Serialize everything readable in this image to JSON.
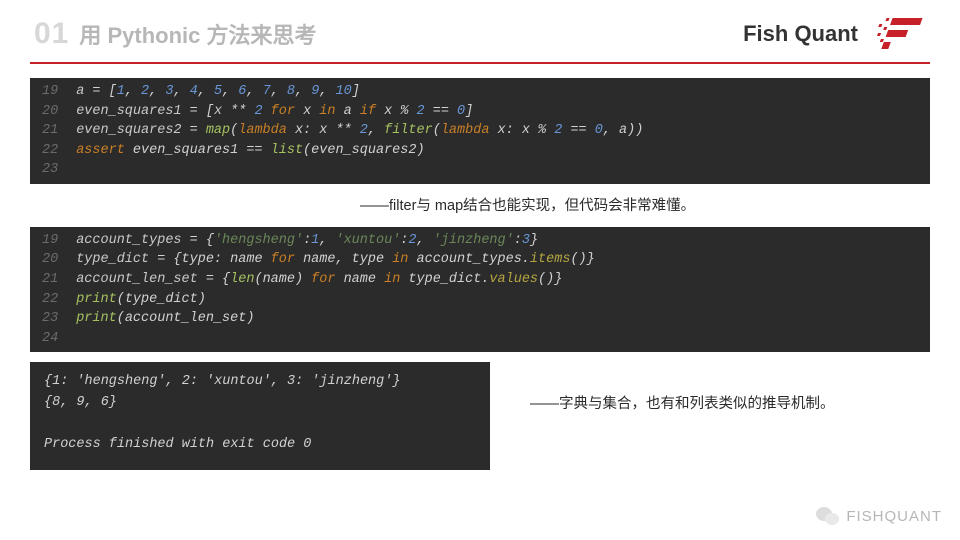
{
  "header": {
    "chapter_num": "01",
    "chapter_title": "用 Pythonic 方法来思考",
    "brand": "Fish Quant"
  },
  "block1": {
    "gutter": [
      "19",
      "20",
      "21",
      "22",
      "23"
    ],
    "lines": [
      [
        {
          "c": "var",
          "t": "a "
        },
        {
          "c": "op",
          "t": "= "
        },
        {
          "c": "par",
          "t": "["
        },
        {
          "c": "num",
          "t": "1"
        },
        {
          "c": "op",
          "t": ", "
        },
        {
          "c": "num",
          "t": "2"
        },
        {
          "c": "op",
          "t": ", "
        },
        {
          "c": "num",
          "t": "3"
        },
        {
          "c": "op",
          "t": ", "
        },
        {
          "c": "num",
          "t": "4"
        },
        {
          "c": "op",
          "t": ", "
        },
        {
          "c": "num",
          "t": "5"
        },
        {
          "c": "op",
          "t": ", "
        },
        {
          "c": "num",
          "t": "6"
        },
        {
          "c": "op",
          "t": ", "
        },
        {
          "c": "num",
          "t": "7"
        },
        {
          "c": "op",
          "t": ", "
        },
        {
          "c": "num",
          "t": "8"
        },
        {
          "c": "op",
          "t": ", "
        },
        {
          "c": "num",
          "t": "9"
        },
        {
          "c": "op",
          "t": ", "
        },
        {
          "c": "num",
          "t": "10"
        },
        {
          "c": "par",
          "t": "]"
        }
      ],
      [
        {
          "c": "var",
          "t": "even_squares1 "
        },
        {
          "c": "op",
          "t": "= "
        },
        {
          "c": "par",
          "t": "["
        },
        {
          "c": "var",
          "t": "x "
        },
        {
          "c": "op",
          "t": "** "
        },
        {
          "c": "num",
          "t": "2"
        },
        {
          "c": "op",
          "t": " "
        },
        {
          "c": "kw",
          "t": "for"
        },
        {
          "c": "op",
          "t": " x "
        },
        {
          "c": "kw",
          "t": "in"
        },
        {
          "c": "op",
          "t": " a "
        },
        {
          "c": "kw",
          "t": "if"
        },
        {
          "c": "op",
          "t": " x % "
        },
        {
          "c": "num",
          "t": "2"
        },
        {
          "c": "op",
          "t": " == "
        },
        {
          "c": "num",
          "t": "0"
        },
        {
          "c": "par",
          "t": "]"
        }
      ],
      [
        {
          "c": "var",
          "t": "even_squares2 "
        },
        {
          "c": "op",
          "t": "= "
        },
        {
          "c": "fn",
          "t": "map"
        },
        {
          "c": "par",
          "t": "("
        },
        {
          "c": "kw",
          "t": "lambda"
        },
        {
          "c": "op",
          "t": " x: x ** "
        },
        {
          "c": "num",
          "t": "2"
        },
        {
          "c": "op",
          "t": ", "
        },
        {
          "c": "fn",
          "t": "filter"
        },
        {
          "c": "par",
          "t": "("
        },
        {
          "c": "kw",
          "t": "lambda"
        },
        {
          "c": "op",
          "t": " x: x % "
        },
        {
          "c": "num",
          "t": "2"
        },
        {
          "c": "op",
          "t": " == "
        },
        {
          "c": "num",
          "t": "0"
        },
        {
          "c": "op",
          "t": ", a"
        },
        {
          "c": "par",
          "t": "))"
        }
      ],
      [
        {
          "c": "kw",
          "t": "assert"
        },
        {
          "c": "op",
          "t": " even_squares1 == "
        },
        {
          "c": "fn",
          "t": "list"
        },
        {
          "c": "par",
          "t": "("
        },
        {
          "c": "op",
          "t": "even_squares2"
        },
        {
          "c": "par",
          "t": ")"
        }
      ],
      [
        {
          "c": "emp",
          "t": " "
        }
      ]
    ]
  },
  "annot1": "——filter与 map结合也能实现，但代码会非常难懂。",
  "block2": {
    "gutter": [
      "19",
      "20",
      "21",
      "22",
      "23",
      "24"
    ],
    "lines": [
      [
        {
          "c": "var",
          "t": "account_types "
        },
        {
          "c": "op",
          "t": "= "
        },
        {
          "c": "par",
          "t": "{"
        },
        {
          "c": "str",
          "t": "'hengsheng'"
        },
        {
          "c": "op",
          "t": ":"
        },
        {
          "c": "num",
          "t": "1"
        },
        {
          "c": "op",
          "t": ", "
        },
        {
          "c": "str",
          "t": "'xuntou'"
        },
        {
          "c": "op",
          "t": ":"
        },
        {
          "c": "num",
          "t": "2"
        },
        {
          "c": "op",
          "t": ", "
        },
        {
          "c": "str",
          "t": "'jinzheng'"
        },
        {
          "c": "op",
          "t": ":"
        },
        {
          "c": "num",
          "t": "3"
        },
        {
          "c": "par",
          "t": "}"
        }
      ],
      [
        {
          "c": "var",
          "t": "type_dict "
        },
        {
          "c": "op",
          "t": "= "
        },
        {
          "c": "par",
          "t": "{"
        },
        {
          "c": "op",
          "t": "type: name "
        },
        {
          "c": "kw",
          "t": "for"
        },
        {
          "c": "op",
          "t": " name, type "
        },
        {
          "c": "kw",
          "t": "in"
        },
        {
          "c": "op",
          "t": " account_types."
        },
        {
          "c": "fn2",
          "t": "items"
        },
        {
          "c": "par",
          "t": "()}"
        }
      ],
      [
        {
          "c": "var",
          "t": "account_len_set "
        },
        {
          "c": "op",
          "t": "= "
        },
        {
          "c": "par",
          "t": "{"
        },
        {
          "c": "fn",
          "t": "len"
        },
        {
          "c": "par",
          "t": "("
        },
        {
          "c": "op",
          "t": "name"
        },
        {
          "c": "par",
          "t": ") "
        },
        {
          "c": "kw",
          "t": "for"
        },
        {
          "c": "op",
          "t": " name "
        },
        {
          "c": "kw",
          "t": "in"
        },
        {
          "c": "op",
          "t": " type_dict."
        },
        {
          "c": "fn2",
          "t": "values"
        },
        {
          "c": "par",
          "t": "()}"
        }
      ],
      [
        {
          "c": "fn",
          "t": "print"
        },
        {
          "c": "par",
          "t": "("
        },
        {
          "c": "op",
          "t": "type_dict"
        },
        {
          "c": "par",
          "t": ")"
        }
      ],
      [
        {
          "c": "fn",
          "t": "print"
        },
        {
          "c": "par",
          "t": "("
        },
        {
          "c": "op",
          "t": "account_len_set"
        },
        {
          "c": "par",
          "t": ")"
        }
      ],
      [
        {
          "c": "emp",
          "t": " "
        }
      ]
    ]
  },
  "output": "{1: 'hengsheng', 2: 'xuntou', 3: 'jinzheng'}\n{8, 9, 6}\n\nProcess finished with exit code 0",
  "annot2": "——字典与集合，也有和列表类似的推导机制。",
  "watermark": "FISHQUANT"
}
